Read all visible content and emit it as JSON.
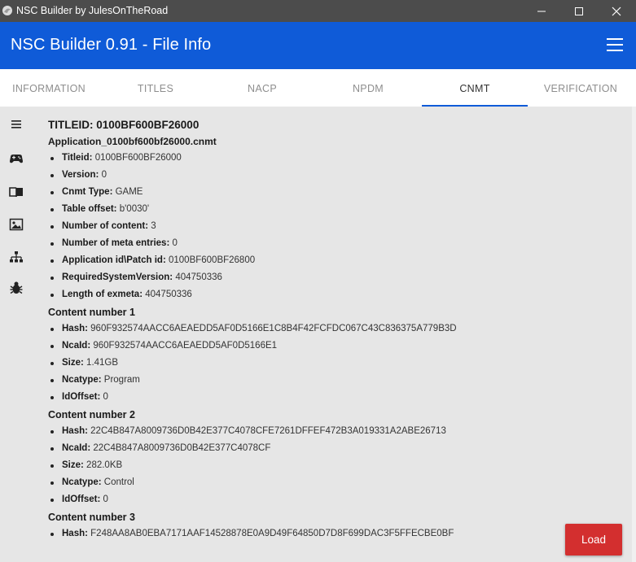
{
  "window": {
    "title": "NSC Builder by JulesOnTheRoad"
  },
  "header": {
    "title": "NSC Builder 0.91 - File Info"
  },
  "tabs": [
    {
      "label": "INFORMATION",
      "active": false
    },
    {
      "label": "TITLES",
      "active": false
    },
    {
      "label": "NACP",
      "active": false
    },
    {
      "label": "NPDM",
      "active": false
    },
    {
      "label": "CNMT",
      "active": true
    },
    {
      "label": "VERIFICATION",
      "active": false
    }
  ],
  "rail": [
    "menu-icon",
    "gamepad-icon",
    "book-icon",
    "image-icon",
    "sitemap-icon",
    "bug-icon"
  ],
  "cnmt": {
    "title": "TITLEID: 0100BF600BF26000",
    "file": "Application_0100bf600bf26000.cnmt",
    "props": [
      {
        "k": "Titleid:",
        "v": "0100BF600BF26000"
      },
      {
        "k": "Version:",
        "v": "0"
      },
      {
        "k": "Cnmt Type:",
        "v": "GAME"
      },
      {
        "k": "Table offset:",
        "v": "b'0030'"
      },
      {
        "k": "Number of content:",
        "v": "3"
      },
      {
        "k": "Number of meta entries:",
        "v": "0"
      },
      {
        "k": "Application id\\Patch id:",
        "v": "0100BF600BF26800"
      },
      {
        "k": "RequiredSystemVersion:",
        "v": "404750336"
      },
      {
        "k": "Length of exmeta:",
        "v": "404750336"
      }
    ],
    "contents": [
      {
        "title": "Content number 1",
        "props": [
          {
            "k": "Hash:",
            "v": "960F932574AACC6AEAEDD5AF0D5166E1C8B4F42FCFDC067C43C836375A779B3D"
          },
          {
            "k": "NcaId:",
            "v": "960F932574AACC6AEAEDD5AF0D5166E1"
          },
          {
            "k": "Size:",
            "v": "1.41GB"
          },
          {
            "k": "Ncatype:",
            "v": "Program"
          },
          {
            "k": "IdOffset:",
            "v": "0"
          }
        ]
      },
      {
        "title": "Content number 2",
        "props": [
          {
            "k": "Hash:",
            "v": "22C4B847A8009736D0B42E377C4078CFE7261DFFEF472B3A019331A2ABE26713"
          },
          {
            "k": "NcaId:",
            "v": "22C4B847A8009736D0B42E377C4078CF"
          },
          {
            "k": "Size:",
            "v": "282.0KB"
          },
          {
            "k": "Ncatype:",
            "v": "Control"
          },
          {
            "k": "IdOffset:",
            "v": "0"
          }
        ]
      },
      {
        "title": "Content number 3",
        "props": [
          {
            "k": "Hash:",
            "v": "F248AA8AB0EBA7171AAF14528878E0A9D49F64850D7D8F699DAC3F5FFECBE0BF"
          }
        ]
      }
    ]
  },
  "actions": {
    "load_label": "Load"
  },
  "colors": {
    "header": "#0f5bd8",
    "load": "#d32f2f",
    "titlebar": "#4c4c4c"
  }
}
